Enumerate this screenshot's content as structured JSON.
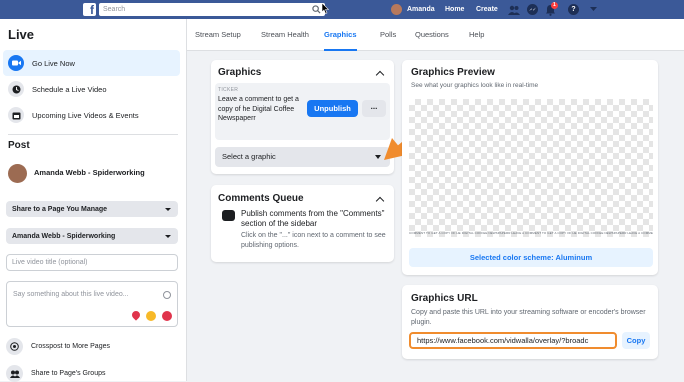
{
  "topbar": {
    "logo": "f",
    "search_placeholder": "Search",
    "user_name": "Amanda",
    "nav_home": "Home",
    "nav_create": "Create",
    "notification_count": "1"
  },
  "sidebar": {
    "title": "Live",
    "items": [
      {
        "label": "Go Live Now",
        "icon": "video-camera-icon"
      },
      {
        "label": "Schedule a Live Video",
        "icon": "clock-icon"
      },
      {
        "label": "Upcoming Live Videos & Events",
        "icon": "calendar-icon"
      }
    ],
    "post_heading": "Post",
    "author": "Amanda Webb - Spiderworking",
    "share_dropdown": "Share to a Page You Manage",
    "page_dropdown": "Amanda Webb - Spiderworking",
    "title_placeholder": "Live video title (optional)",
    "description_placeholder": "Say something about this live video...",
    "crosspost": "Crosspost to More Pages",
    "share_groups": "Share to Page's Groups"
  },
  "tabs": [
    "Stream Setup",
    "Stream Health",
    "Graphics",
    "Polls",
    "Questions",
    "Help"
  ],
  "active_tab": "Graphics",
  "graphics_card": {
    "title": "Graphics",
    "ticker_label": "TICKER",
    "ticker_text": "Leave a comment to get a copy of he Digital Coffee Newspaperr",
    "unpublish_label": "Unpublish",
    "more_label": "...",
    "select_label": "Select a graphic"
  },
  "comments_queue": {
    "title": "Comments Queue",
    "main_text": "Publish comments from the \"Comments\" section of the sidebar",
    "sub_text": "Click on the \"...\" icon next to a comment to see publishing options."
  },
  "graphics_preview": {
    "title": "Graphics Preview",
    "subtitle": "See what your graphics look like in real-time",
    "ticker_strip": "COMMENT TO GET A COPY OF HE DIGITAL COFFEE NEWSPAPERR     LEAVE A COMMENT TO GET A COPY OF HE DIGITAL COFFEE NEWSPAPERR     LEAVE A COMMENT TO GET A COPY OF HE DIGITAL COFFEE NEWSPAPERR     LEA",
    "color_scheme": "Selected color scheme: Aluminum"
  },
  "graphics_url": {
    "title": "Graphics URL",
    "description": "Copy and paste this URL into your streaming software or encoder's browser plugin.",
    "url": "https://www.facebook.com/vidwalla/overlay/?broadc",
    "copy_label": "Copy"
  },
  "colors": {
    "brand_blue": "#1877f2",
    "topbar": "#3b5998",
    "highlight_orange": "#f08c2e"
  }
}
